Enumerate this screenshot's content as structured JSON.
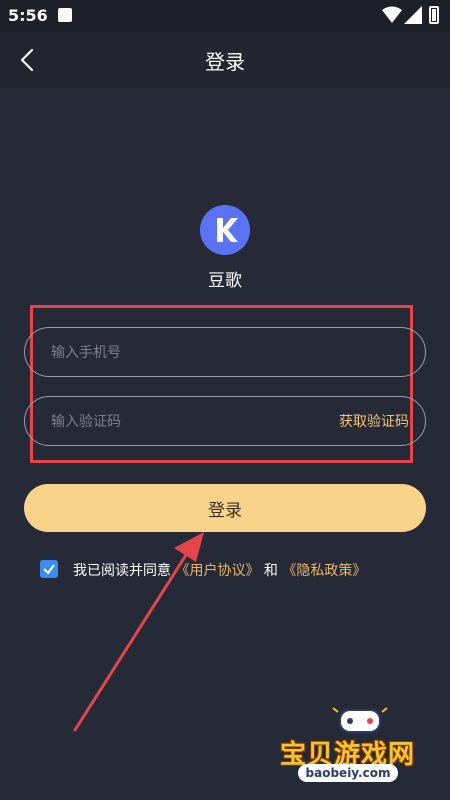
{
  "status_bar": {
    "time": "5:56"
  },
  "nav": {
    "title": "登录"
  },
  "app": {
    "name": "豆歌",
    "logo_letter": "K"
  },
  "form": {
    "phone_placeholder": "输入手机号",
    "code_placeholder": "输入验证码",
    "get_code_label": "获取验证码",
    "login_label": "登录"
  },
  "agreement": {
    "prefix": "我已阅读并同意 ",
    "user_agreement": "《用户协议》",
    "conjunction": " 和 ",
    "privacy_policy": "《隐私政策》",
    "checked": true
  },
  "watermark": {
    "title": "宝贝游戏网",
    "url": "baobeiy.com"
  },
  "colors": {
    "background": "#262a36",
    "accent": "#fad38a",
    "link": "#e8b86a",
    "checkbox": "#3b8cf0",
    "highlight": "#e5464e",
    "logo": "#5b72f5"
  }
}
